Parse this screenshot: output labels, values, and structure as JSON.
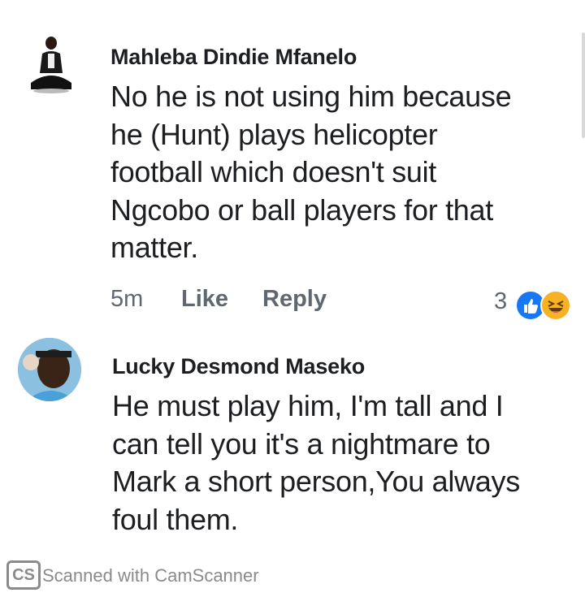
{
  "comments": [
    {
      "author": "Mahleba Dindie Mfanelo",
      "text": "No he is not using him because\nhe (Hunt) plays helicopter\nfootball which doesn't suit\nNgcobo or ball players for that\nmatter.",
      "time": "5m",
      "like_label": "Like",
      "reply_label": "Reply",
      "reaction_count": "3",
      "reactions": [
        "like-icon",
        "haha-icon"
      ]
    },
    {
      "author": "Lucky Desmond Maseko",
      "text": "He must play him, I'm tall and I\ncan tell you it's a nightmare to\nMark a short person,You always\nfoul them."
    }
  ],
  "watermark": {
    "logo": "CS",
    "text": "Scanned with CamScanner"
  },
  "colors": {
    "like_blue": "#1877f2",
    "haha_yellow": "#f7b125",
    "meta_gray": "#606770"
  }
}
